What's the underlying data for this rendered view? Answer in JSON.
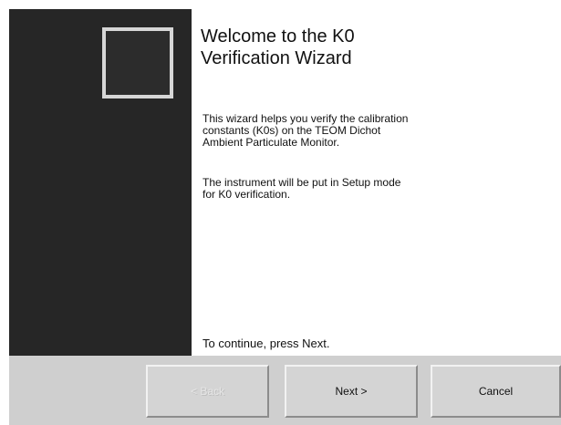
{
  "wizard": {
    "title": "Welcome to the K0\nVerification Wizard",
    "description_1": "This wizard helps you verify the calibration\nconstants (K0s) on the TEOM Dichot\nAmbient Particulate Monitor.",
    "description_2": "The instrument will be put in Setup mode\nfor K0 verification.",
    "continue_text": "To continue, press Next.",
    "side_icon": "wizard-logo-square-icon"
  },
  "buttons": {
    "back_label": "< Back",
    "back_enabled": false,
    "next_label": "Next >",
    "cancel_label": "Cancel"
  },
  "colors": {
    "side_panel": "#262626",
    "button_bar": "#cfcfcf",
    "button_face": "#d4d4d4"
  }
}
